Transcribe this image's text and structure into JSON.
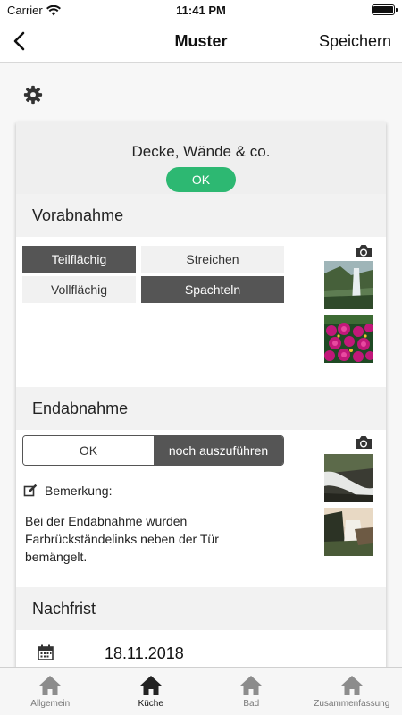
{
  "status_bar": {
    "carrier": "Carrier",
    "time": "11:41 PM"
  },
  "nav": {
    "title": "Muster",
    "save_label": "Speichern"
  },
  "room": {
    "title": "Decke, Wände & co.",
    "status_label": "OK"
  },
  "sections": {
    "vorabnahme": {
      "title": "Vorabnahme",
      "options": [
        {
          "label": "Teilflächig",
          "active": true
        },
        {
          "label": "Streichen",
          "active": false
        },
        {
          "label": "Vollflächig",
          "active": false
        },
        {
          "label": "Spachteln",
          "active": true
        }
      ]
    },
    "endabnahme": {
      "title": "Endabnahme",
      "segment_ok": "OK",
      "segment_todo": "noch auszuführen",
      "selected": "noch auszuführen",
      "remark_label": "Bemerkung:",
      "remark_text": "Bei der Endabnahme wurden Farbrückständelinks neben der Tür bemängelt."
    },
    "nachfrist": {
      "title": "Nachfrist",
      "date": "18.11.2018"
    }
  },
  "tabs": [
    {
      "label": "Allgemein",
      "active": false
    },
    {
      "label": "Küche",
      "active": true
    },
    {
      "label": "Bad",
      "active": false
    },
    {
      "label": "Zusammenfassung",
      "active": false
    }
  ],
  "colors": {
    "accent_green": "#2db872",
    "active_button": "#555555",
    "tab_active": "#222222",
    "tab_inactive": "#8c8c8c"
  }
}
